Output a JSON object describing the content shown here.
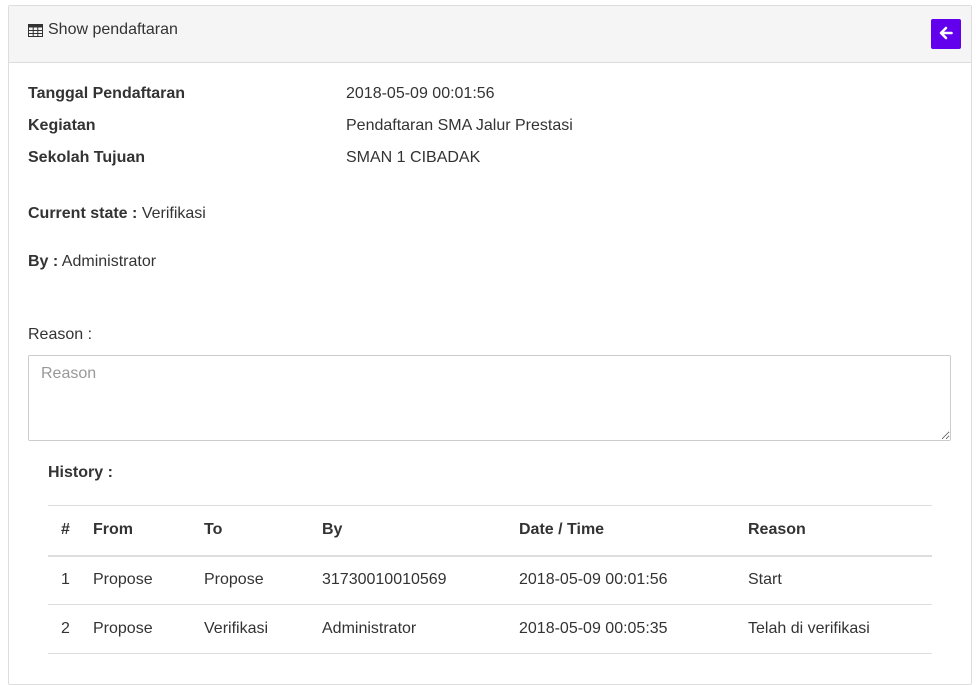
{
  "header": {
    "title": "Show pendaftaran",
    "accent_color": "#6200ee"
  },
  "details": [
    {
      "label": "Tanggal Pendaftaran",
      "value": "2018-05-09 00:01:56"
    },
    {
      "label": "Kegiatan",
      "value": "Pendaftaran SMA Jalur Prestasi"
    },
    {
      "label": "Sekolah Tujuan",
      "value": "SMAN 1 CIBADAK"
    }
  ],
  "state": {
    "current_label": "Current state :",
    "current_value": "Verifikasi",
    "by_label": "By :",
    "by_value": "Administrator"
  },
  "reason": {
    "label": "Reason :",
    "placeholder": "Reason",
    "value": ""
  },
  "history": {
    "title": "History :",
    "columns": [
      "#",
      "From",
      "To",
      "By",
      "Date / Time",
      "Reason"
    ],
    "rows": [
      [
        "1",
        "Propose",
        "Propose",
        "31730010010569",
        "2018-05-09 00:01:56",
        "Start"
      ],
      [
        "2",
        "Propose",
        "Verifikasi",
        "Administrator",
        "2018-05-09 00:05:35",
        "Telah di verifikasi"
      ]
    ]
  }
}
